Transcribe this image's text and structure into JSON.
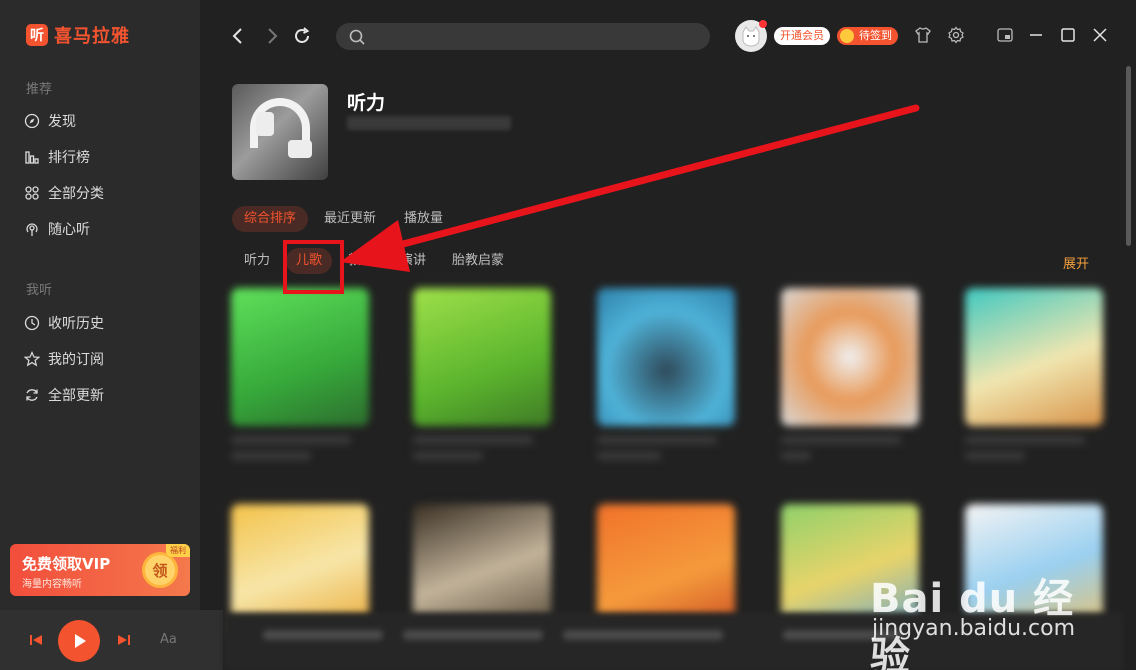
{
  "app": {
    "logo_glyph": "听",
    "name": "喜马拉雅"
  },
  "sidebar": {
    "section_recommend": "推荐",
    "recommend_items": [
      {
        "label": "发现",
        "icon": "compass-icon"
      },
      {
        "label": "排行榜",
        "icon": "ranking-icon"
      },
      {
        "label": "全部分类",
        "icon": "category-grid-icon"
      },
      {
        "label": "随心听",
        "icon": "radio-icon"
      }
    ],
    "section_mine": "我听",
    "mine_items": [
      {
        "label": "收听历史",
        "icon": "clock-icon"
      },
      {
        "label": "我的订阅",
        "icon": "star-icon"
      },
      {
        "label": "全部更新",
        "icon": "refresh-icon"
      }
    ],
    "vip_card": {
      "title": "免费领取VIP",
      "subtitle": "海量内容畅听",
      "coin_label": "领",
      "tag": "福利"
    }
  },
  "player": {
    "lyric_toggle": "Aa"
  },
  "topbar": {
    "search_placeholder": "",
    "vip_button": "开通会员",
    "sign_button": "待签到"
  },
  "category": {
    "title": "听力",
    "sort_tabs": [
      "综合排序",
      "最近更新",
      "播放量"
    ],
    "sort_active_index": 0,
    "sub_tabs": [
      "听力",
      "儿歌",
      "教材",
      "演讲",
      "胎教启蒙"
    ],
    "sub_active_index": 1,
    "expand_label": "展开"
  },
  "colors": {
    "accent": "#f3542f",
    "annotation_red": "#e8141c",
    "sidebar_bg": "#2b2b2b",
    "main_bg": "#212121"
  },
  "watermark": {
    "brand": "Bai du 经验",
    "url": "jingyan.baidu.com"
  }
}
